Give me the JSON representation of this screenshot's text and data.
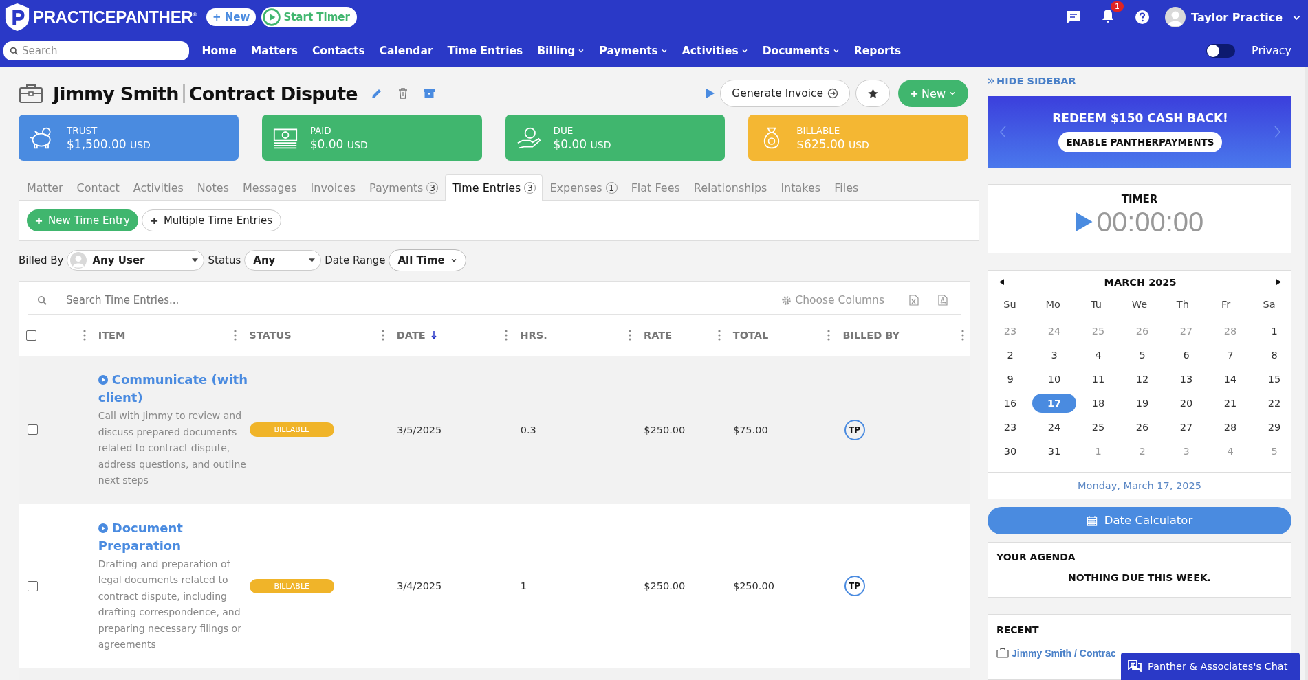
{
  "brand": {
    "name": "PRACTICEPANTHER$^{®}$"
  },
  "top_buttons": [
    {
      "kind": "new",
      "label": "+ New"
    },
    {
      "kind": "timer",
      "label": "Start Timer"
    }
  ],
  "notifications": {
    "count": "1"
  },
  "user": {
    "name": "Taylor Practice"
  },
  "search": {
    "placeholder": "Search"
  },
  "nav": [
    {
      "label": "Home",
      "dropdown": false
    },
    {
      "label": "Matters",
      "dropdown": false
    },
    {
      "label": "Contacts",
      "dropdown": false
    },
    {
      "label": "Calendar",
      "dropdown": false
    },
    {
      "label": "Time Entries",
      "dropdown": false
    },
    {
      "label": "Billing",
      "dropdown": true
    },
    {
      "label": "Payments",
      "dropdown": true
    },
    {
      "label": "Activities",
      "dropdown": true
    },
    {
      "label": "Documents",
      "dropdown": true
    },
    {
      "label": "Reports",
      "dropdown": false
    }
  ],
  "privacy": {
    "label": "Privacy",
    "on": false
  },
  "matter": {
    "client": "Jimmy Smith",
    "title": "Contract Dispute"
  },
  "actions": {
    "generate": "Generate Invoice",
    "new": "New"
  },
  "summary_cards": [
    {
      "kind": "trust",
      "label": "TRUST",
      "amount": "$1,500.00",
      "currency": "USD",
      "color": "#4a8be0"
    },
    {
      "kind": "paid",
      "label": "PAID",
      "amount": "$0.00",
      "currency": "USD",
      "color": "#40b66e"
    },
    {
      "kind": "due",
      "label": "DUE",
      "amount": "$0.00",
      "currency": "USD",
      "color": "#40b66e"
    },
    {
      "kind": "billable",
      "label": "BILLABLE",
      "amount": "$625.00",
      "currency": "USD",
      "color": "#f4b733"
    }
  ],
  "tabs": [
    {
      "label": "Matter",
      "selected": false
    },
    {
      "label": "Contact",
      "selected": false
    },
    {
      "label": "Activities",
      "selected": false
    },
    {
      "label": "Notes",
      "selected": false
    },
    {
      "label": "Messages",
      "selected": false
    },
    {
      "label": "Invoices",
      "selected": false
    },
    {
      "label": "Payments",
      "count": "3",
      "selected": false
    },
    {
      "label": "Time Entries",
      "count": "3",
      "selected": true
    },
    {
      "label": "Expenses",
      "count": "1",
      "selected": false
    },
    {
      "label": "Flat Fees",
      "selected": false
    },
    {
      "label": "Relationships",
      "selected": false
    },
    {
      "label": "Intakes",
      "selected": false
    },
    {
      "label": "Files",
      "selected": false
    }
  ],
  "tab_buttons": [
    {
      "kind": "primary",
      "label": "New Time Entry"
    },
    {
      "kind": "secondary",
      "label": "Multiple Time Entries"
    }
  ],
  "filters": [
    {
      "kind": "user",
      "label": "Billed By",
      "value": "Any User"
    },
    {
      "kind": "select",
      "label": "Status",
      "value": "Any"
    },
    {
      "kind": "pill",
      "label": "Date Range",
      "value": "All Time"
    }
  ],
  "table": {
    "select_all": {
      "checked": false
    },
    "search_placeholder": "Search Time Entries...",
    "choose_columns": "Choose Columns",
    "columns": [
      {
        "label": "ITEM",
        "sorted": false
      },
      {
        "label": "STATUS",
        "sorted": false
      },
      {
        "label": "DATE",
        "sorted": true
      },
      {
        "label": "HRS.",
        "sorted": false
      },
      {
        "label": "RATE",
        "sorted": false
      },
      {
        "label": "TOTAL",
        "sorted": false
      },
      {
        "label": "BILLED BY",
        "sorted": false
      }
    ],
    "rows": [
      {
        "title": "Communicate (with client)",
        "description": "Call with Jimmy to review and discuss prepared documents related to contract dispute, address questions, and outline next steps",
        "status": "BILLABLE",
        "date": "3/5/2025",
        "hrs": "0.3",
        "rate": "$250.00",
        "total": "$75.00",
        "billed_by": "TP",
        "checked": false
      },
      {
        "title": "Document Preparation",
        "description": "Drafting and preparation of legal documents related to contract dispute, including drafting correspondence, and preparing necessary filings or agreements",
        "status": "BILLABLE",
        "date": "3/4/2025",
        "hrs": "1",
        "rate": "$250.00",
        "total": "$250.00",
        "billed_by": "TP",
        "checked": false
      }
    ]
  },
  "sidebar": {
    "hide": "HIDE SIDEBAR",
    "promo": {
      "title": "REDEEM $150 CASH BACK!",
      "button": "ENABLE PANTHERPAYMENTS"
    },
    "timer": {
      "title": "TIMER",
      "time": "00:00:00"
    },
    "calendar": {
      "month": "MARCH 2025",
      "weekdays": [
        "Su",
        "Mo",
        "Tu",
        "We",
        "Th",
        "Fr",
        "Sa"
      ],
      "days": [
        {
          "day": "23",
          "muted": true,
          "selected": false
        },
        {
          "day": "24",
          "muted": true,
          "selected": false
        },
        {
          "day": "25",
          "muted": true,
          "selected": false
        },
        {
          "day": "26",
          "muted": true,
          "selected": false
        },
        {
          "day": "27",
          "muted": true,
          "selected": false
        },
        {
          "day": "28",
          "muted": true,
          "selected": false
        },
        {
          "day": "1",
          "muted": false,
          "selected": false
        },
        {
          "day": "2",
          "muted": false,
          "selected": false
        },
        {
          "day": "3",
          "muted": false,
          "selected": false
        },
        {
          "day": "4",
          "muted": false,
          "selected": false
        },
        {
          "day": "5",
          "muted": false,
          "selected": false
        },
        {
          "day": "6",
          "muted": false,
          "selected": false
        },
        {
          "day": "7",
          "muted": false,
          "selected": false
        },
        {
          "day": "8",
          "muted": false,
          "selected": false
        },
        {
          "day": "9",
          "muted": false,
          "selected": false
        },
        {
          "day": "10",
          "muted": false,
          "selected": false
        },
        {
          "day": "11",
          "muted": false,
          "selected": false
        },
        {
          "day": "12",
          "muted": false,
          "selected": false
        },
        {
          "day": "13",
          "muted": false,
          "selected": false
        },
        {
          "day": "14",
          "muted": false,
          "selected": false
        },
        {
          "day": "15",
          "muted": false,
          "selected": false
        },
        {
          "day": "16",
          "muted": false,
          "selected": false
        },
        {
          "day": "17",
          "muted": false,
          "selected": true
        },
        {
          "day": "18",
          "muted": false,
          "selected": false
        },
        {
          "day": "19",
          "muted": false,
          "selected": false
        },
        {
          "day": "20",
          "muted": false,
          "selected": false
        },
        {
          "day": "21",
          "muted": false,
          "selected": false
        },
        {
          "day": "22",
          "muted": false,
          "selected": false
        },
        {
          "day": "23",
          "muted": false,
          "selected": false
        },
        {
          "day": "24",
          "muted": false,
          "selected": false
        },
        {
          "day": "25",
          "muted": false,
          "selected": false
        },
        {
          "day": "26",
          "muted": false,
          "selected": false
        },
        {
          "day": "27",
          "muted": false,
          "selected": false
        },
        {
          "day": "28",
          "muted": false,
          "selected": false
        },
        {
          "day": "29",
          "muted": false,
          "selected": false
        },
        {
          "day": "30",
          "muted": false,
          "selected": false
        },
        {
          "day": "31",
          "muted": false,
          "selected": false
        },
        {
          "day": "1",
          "muted": true,
          "selected": false
        },
        {
          "day": "2",
          "muted": true,
          "selected": false
        },
        {
          "day": "3",
          "muted": true,
          "selected": false
        },
        {
          "day": "4",
          "muted": true,
          "selected": false
        },
        {
          "day": "5",
          "muted": true,
          "selected": false
        }
      ],
      "selected_date": "Monday, March 17, 2025"
    },
    "date_calculator": "Date Calculator",
    "agenda": {
      "title": "YOUR AGENDA",
      "empty": "NOTHING DUE THIS WEEK."
    },
    "recent": {
      "title": "RECENT",
      "items": [
        "Jimmy Smith / Contrac"
      ]
    }
  },
  "chat": {
    "label": "Panther & Associates's Chat"
  }
}
